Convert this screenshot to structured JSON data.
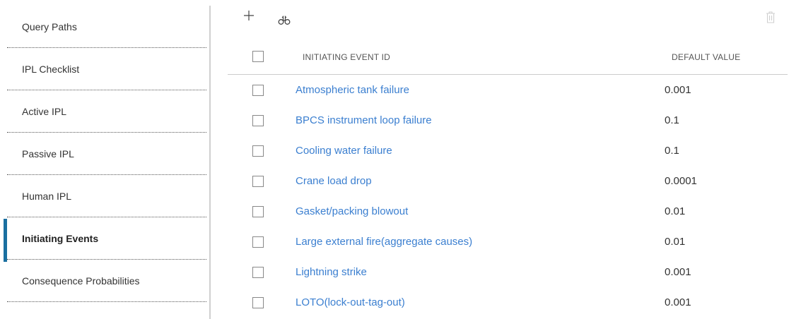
{
  "sidebar": {
    "items": [
      {
        "label": "Query Paths",
        "active": false
      },
      {
        "label": "IPL Checklist",
        "active": false
      },
      {
        "label": "Active IPL",
        "active": false
      },
      {
        "label": "Passive IPL",
        "active": false
      },
      {
        "label": "Human IPL",
        "active": false
      },
      {
        "label": "Initiating Events",
        "active": true
      },
      {
        "label": "Consequence Probabilities",
        "active": false
      }
    ]
  },
  "toolbar": {
    "add_icon": "plus-icon",
    "search_icon": "binoculars-icon",
    "delete_icon": "trash-icon"
  },
  "table": {
    "headers": {
      "id": "INITIATING EVENT ID",
      "value": "DEFAULT VALUE"
    },
    "rows": [
      {
        "id": "Atmospheric tank failure",
        "value": "0.001"
      },
      {
        "id": "BPCS instrument loop failure",
        "value": "0.1"
      },
      {
        "id": "Cooling water failure",
        "value": "0.1"
      },
      {
        "id": "Crane load drop",
        "value": "0.0001"
      },
      {
        "id": "Gasket/packing blowout",
        "value": "0.01"
      },
      {
        "id": "Large external fire(aggregate causes)",
        "value": "0.01"
      },
      {
        "id": "Lightning strike",
        "value": "0.001"
      },
      {
        "id": "LOTO(lock-out-tag-out)",
        "value": "0.001"
      }
    ]
  },
  "colors": {
    "link": "#3b7fd0",
    "active_bar": "#1a6fa0"
  }
}
